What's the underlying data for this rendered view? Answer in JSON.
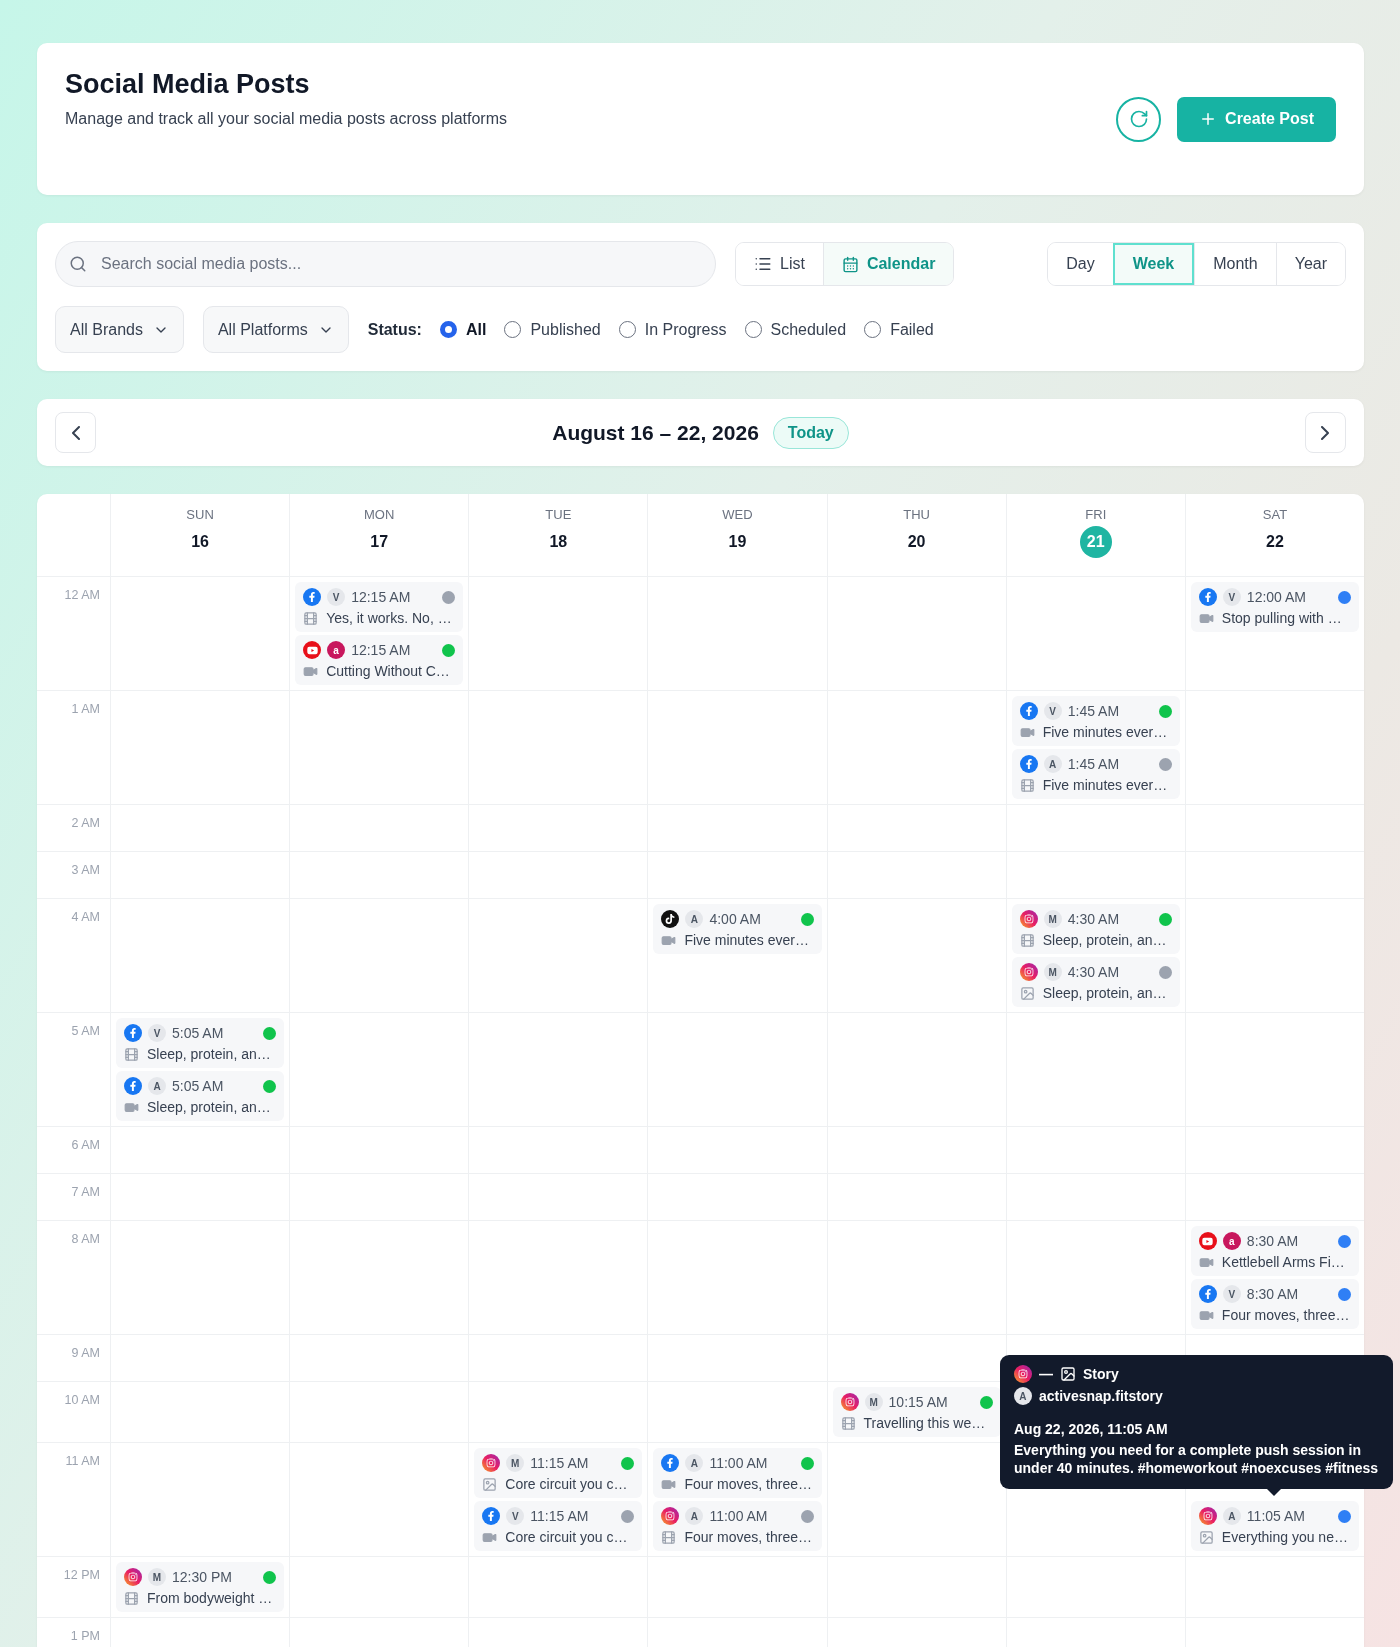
{
  "header": {
    "title": "Social Media Posts",
    "subtitle": "Manage and track all your social media posts across platforms",
    "create_button": "Create Post"
  },
  "filters": {
    "search": {
      "placeholder": "Search social media posts..."
    },
    "view_toggle": [
      {
        "label": "List",
        "selected": false
      },
      {
        "label": "Calendar",
        "selected": true
      }
    ],
    "ranges": [
      {
        "label": "Day",
        "selected": false
      },
      {
        "label": "Week",
        "selected": true
      },
      {
        "label": "Month",
        "selected": false
      },
      {
        "label": "Year",
        "selected": false
      }
    ],
    "dropdowns": [
      "All Brands",
      "All Platforms"
    ],
    "status_label": "Status:",
    "statuses": [
      {
        "label": "All",
        "selected": true
      },
      {
        "label": "Published",
        "selected": false
      },
      {
        "label": "In Progress",
        "selected": false
      },
      {
        "label": "Scheduled",
        "selected": false
      },
      {
        "label": "Failed",
        "selected": false
      }
    ]
  },
  "week_nav": {
    "title": "August 16 – 22, 2026",
    "today_button": "Today"
  },
  "calendar": {
    "days": [
      {
        "weekday": "SUN",
        "date": "16",
        "today": false
      },
      {
        "weekday": "MON",
        "date": "17",
        "today": false
      },
      {
        "weekday": "TUE",
        "date": "18",
        "today": false
      },
      {
        "weekday": "WED",
        "date": "19",
        "today": false
      },
      {
        "weekday": "THU",
        "date": "20",
        "today": false
      },
      {
        "weekday": "FRI",
        "date": "21",
        "today": true
      },
      {
        "weekday": "SAT",
        "date": "22",
        "today": false
      }
    ],
    "hours": [
      {
        "label": "12 AM",
        "cells": [
          null,
          {
            "posts": [
              {
                "platform": {
                  "kind": "facebook"
                },
                "brand": {
                  "letter": "V",
                  "color": "#e5e7eb"
                },
                "time": "12:15 AM",
                "color": "#9ca3af",
                "media": {
                  "kind": "carousel"
                },
                "caption": "Yes, it works. No, …"
              },
              {
                "platform": {
                  "kind": "youtube"
                },
                "brand": {
                  "letter": "a",
                  "color": "#c8175d"
                },
                "time": "12:15 AM",
                "color": "#10c44c",
                "media": {
                  "kind": "video"
                },
                "caption": "Cutting Without C…"
              }
            ]
          },
          null,
          null,
          null,
          null,
          {
            "posts": [
              {
                "platform": {
                  "kind": "facebook"
                },
                "brand": {
                  "letter": "V",
                  "color": "#e5e7eb"
                },
                "time": "12:00 AM",
                "color": "#2f7ff5",
                "media": {
                  "kind": "video"
                },
                "caption": "Stop pulling with …"
              }
            ]
          }
        ]
      },
      {
        "label": "1 AM",
        "cells": [
          null,
          null,
          null,
          null,
          null,
          {
            "posts": [
              {
                "platform": {
                  "kind": "facebook"
                },
                "brand": {
                  "letter": "V",
                  "color": "#e5e7eb"
                },
                "time": "1:45 AM",
                "color": "#10c44c",
                "media": {
                  "kind": "video"
                },
                "caption": "Five minutes ever…"
              },
              {
                "platform": {
                  "kind": "facebook"
                },
                "brand": {
                  "letter": "A",
                  "color": "#e5e7eb"
                },
                "time": "1:45 AM",
                "color": "#9ca3af",
                "media": {
                  "kind": "carousel"
                },
                "caption": "Five minutes ever…"
              }
            ]
          },
          null
        ]
      },
      {
        "label": "2 AM",
        "cells": [
          null,
          null,
          null,
          null,
          null,
          null,
          null
        ]
      },
      {
        "label": "3 AM",
        "cells": [
          null,
          null,
          null,
          null,
          null,
          null,
          null
        ]
      },
      {
        "label": "4 AM",
        "cells": [
          null,
          null,
          null,
          {
            "posts": [
              {
                "platform": {
                  "kind": "tiktok"
                },
                "brand": {
                  "letter": "A",
                  "color": "#e5e7eb"
                },
                "time": "4:00 AM",
                "color": "#10c44c",
                "media": {
                  "kind": "video"
                },
                "caption": "Five minutes ever…"
              }
            ]
          },
          null,
          {
            "posts": [
              {
                "platform": {
                  "kind": "instagram"
                },
                "brand": {
                  "letter": "M",
                  "color": "#e5e7eb"
                },
                "time": "4:30 AM",
                "color": "#10c44c",
                "media": {
                  "kind": "carousel"
                },
                "caption": "Sleep, protein, an…"
              },
              {
                "platform": {
                  "kind": "instagram"
                },
                "brand": {
                  "letter": "M",
                  "color": "#e5e7eb"
                },
                "time": "4:30 AM",
                "color": "#9ca3af",
                "media": {
                  "kind": "image"
                },
                "caption": "Sleep, protein, an…"
              }
            ]
          },
          null
        ]
      },
      {
        "label": "5 AM",
        "cells": [
          {
            "posts": [
              {
                "platform": {
                  "kind": "facebook"
                },
                "brand": {
                  "letter": "V",
                  "color": "#e5e7eb"
                },
                "time": "5:05 AM",
                "color": "#10c44c",
                "media": {
                  "kind": "carousel"
                },
                "caption": "Sleep, protein, an…"
              },
              {
                "platform": {
                  "kind": "facebook"
                },
                "brand": {
                  "letter": "A",
                  "color": "#e5e7eb"
                },
                "time": "5:05 AM",
                "color": "#10c44c",
                "media": {
                  "kind": "video"
                },
                "caption": "Sleep, protein, an…"
              }
            ]
          },
          null,
          null,
          null,
          null,
          null,
          null
        ]
      },
      {
        "label": "6 AM",
        "cells": [
          null,
          null,
          null,
          null,
          null,
          null,
          null
        ]
      },
      {
        "label": "7 AM",
        "cells": [
          null,
          null,
          null,
          null,
          null,
          null,
          null
        ]
      },
      {
        "label": "8 AM",
        "cells": [
          null,
          null,
          null,
          null,
          null,
          null,
          {
            "posts": [
              {
                "platform": {
                  "kind": "youtube"
                },
                "brand": {
                  "letter": "a",
                  "color": "#c8175d"
                },
                "time": "8:30 AM",
                "color": "#2f7ff5",
                "media": {
                  "kind": "video"
                },
                "caption": "Kettlebell Arms Fi…"
              },
              {
                "platform": {
                  "kind": "facebook"
                },
                "brand": {
                  "letter": "V",
                  "color": "#e5e7eb"
                },
                "time": "8:30 AM",
                "color": "#2f7ff5",
                "media": {
                  "kind": "video"
                },
                "caption": "Four moves, three…"
              }
            ]
          }
        ]
      },
      {
        "label": "9 AM",
        "cells": [
          null,
          null,
          null,
          null,
          null,
          null,
          null
        ]
      },
      {
        "label": "10 AM",
        "cells": [
          null,
          null,
          null,
          null,
          {
            "posts": [
              {
                "platform": {
                  "kind": "instagram"
                },
                "brand": {
                  "letter": "M",
                  "color": "#e5e7eb"
                },
                "time": "10:15 AM",
                "color": "#10c44c",
                "media": {
                  "kind": "carousel"
                },
                "caption": "Travelling this we…"
              }
            ]
          },
          null,
          null
        ]
      },
      {
        "label": "11 AM",
        "cells": [
          null,
          null,
          {
            "posts": [
              {
                "platform": {
                  "kind": "instagram"
                },
                "brand": {
                  "letter": "M",
                  "color": "#e5e7eb"
                },
                "time": "11:15 AM",
                "color": "#10c44c",
                "media": {
                  "kind": "image"
                },
                "caption": "Core circuit you c…"
              },
              {
                "platform": {
                  "kind": "facebook"
                },
                "brand": {
                  "letter": "V",
                  "color": "#e5e7eb"
                },
                "time": "11:15 AM",
                "color": "#9ca3af",
                "media": {
                  "kind": "video"
                },
                "caption": "Core circuit you c…"
              }
            ]
          },
          {
            "posts": [
              {
                "platform": {
                  "kind": "facebook"
                },
                "brand": {
                  "letter": "A",
                  "color": "#e5e7eb"
                },
                "time": "11:00 AM",
                "color": "#10c44c",
                "media": {
                  "kind": "video"
                },
                "caption": "Four moves, three…"
              },
              {
                "platform": {
                  "kind": "instagram"
                },
                "brand": {
                  "letter": "A",
                  "color": "#e5e7eb"
                },
                "time": "11:00 AM",
                "color": "#9ca3af",
                "media": {
                  "kind": "carousel"
                },
                "caption": "Four moves, three…"
              }
            ]
          },
          null,
          null,
          {
            "posts": [
              {
                "platform": {
                  "kind": "instagram"
                },
                "brand": {
                  "letter": "A",
                  "color": "#e5e7eb"
                },
                "time": "11:05 AM",
                "color": "#2f7ff5",
                "media": {
                  "kind": "image"
                },
                "caption": "Everything you ne…",
                "tooltip": {
                  "platform": {
                    "kind": "instagram"
                  },
                  "separator": "—",
                  "media": {
                    "kind": "image"
                  },
                  "type_label": "Story",
                  "brand": {
                    "letter": "A",
                    "color": "#e5e7eb"
                  },
                  "account": "activesnap.fitstory",
                  "datetime": "Aug 22, 2026, 11:05 AM",
                  "caption": "Everything you need for a complete push session in under 40 minutes. #homeworkout #noexcuses #fitness"
                }
              }
            ]
          }
        ]
      },
      {
        "label": "12 PM",
        "cells": [
          {
            "posts": [
              {
                "platform": {
                  "kind": "instagram"
                },
                "brand": {
                  "letter": "M",
                  "color": "#e5e7eb"
                },
                "time": "12:30 PM",
                "color": "#10c44c",
                "media": {
                  "kind": "carousel"
                },
                "caption": "From bodyweight …"
              }
            ]
          },
          null,
          null,
          null,
          null,
          null,
          null
        ]
      },
      {
        "label": "1 PM",
        "cells": [
          null,
          null,
          null,
          null,
          null,
          null,
          null
        ]
      }
    ]
  }
}
